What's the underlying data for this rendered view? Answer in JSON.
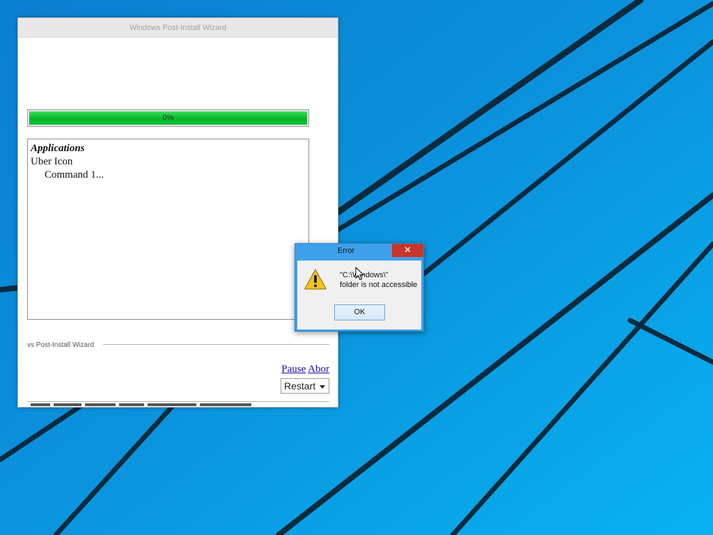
{
  "wizard": {
    "title": "Windows Post-Install Wizard",
    "progress": {
      "value": 0,
      "label": "0%"
    },
    "log": {
      "heading": "Applications",
      "item": "Uber Icon",
      "subitem": "Command 1..."
    },
    "group_label": "vs Post-Install Wizard",
    "links": {
      "pause": "Pause",
      "abort": "Abor"
    },
    "restart_select": {
      "selected": "Restart"
    }
  },
  "error_dialog": {
    "title": "Error",
    "close_glyph": "✕",
    "message_line1": "\"C:\\Windows\\\"",
    "message_line2": "folder is not accessible",
    "ok_label": "OK",
    "icon": "warning-icon"
  },
  "colors": {
    "desktop": "#0c8ad6",
    "progress_green": "#06b42a",
    "close_red": "#c7352b",
    "dialog_frame": "#3ea0ea"
  }
}
